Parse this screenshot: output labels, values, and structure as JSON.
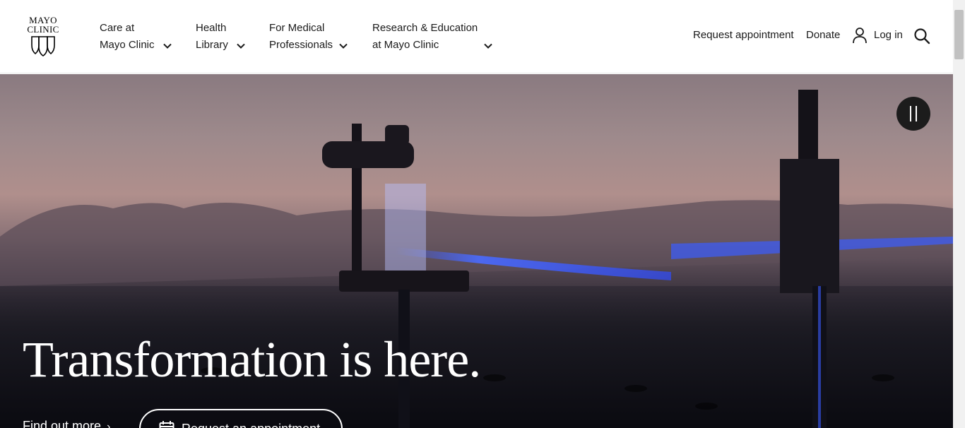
{
  "brand": {
    "logo_line1": "MAYO",
    "logo_line2": "CLINIC"
  },
  "nav": [
    {
      "line1": "Care at",
      "line2": "Mayo Clinic"
    },
    {
      "line1": "Health",
      "line2": "Library"
    },
    {
      "line1": "For Medical",
      "line2": "Professionals"
    },
    {
      "line1": "Research & Education",
      "line2": "at Mayo Clinic"
    }
  ],
  "utility": {
    "request_appointment": "Request appointment",
    "donate": "Donate",
    "login": "Log in"
  },
  "hero": {
    "title": "Transformation is here.",
    "find_more": "Find out more",
    "request_button": "Request an appointment"
  },
  "icons": [
    "shield-logo-icon",
    "chevron-down-icon",
    "user-icon",
    "search-icon",
    "pause-icon",
    "calendar-icon",
    "chevron-right-icon"
  ]
}
